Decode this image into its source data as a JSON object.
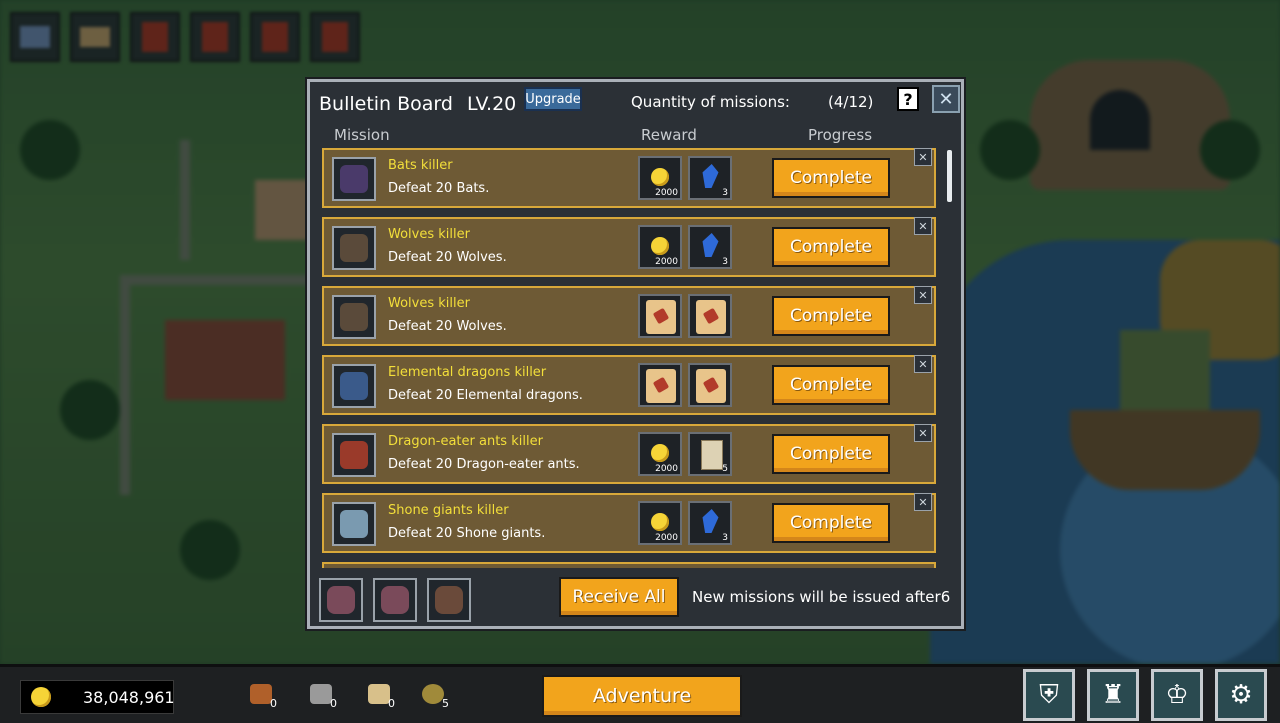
{
  "dialog": {
    "title": "Bulletin Board",
    "level": "LV.20",
    "upgrade_label": "Upgrade",
    "quantity_label": "Quantity of missions:",
    "quantity_value": "(4/12)",
    "help_label": "?",
    "close_label": "✕",
    "columns": {
      "mission": "Mission",
      "reward": "Reward",
      "progress": "Progress"
    },
    "complete_label": "Complete",
    "dismiss_label": "✕",
    "missions": [
      {
        "name": "Bats killer",
        "desc": "Defeat 20 Bats.",
        "portrait_icon": "bat-icon",
        "rewards": [
          {
            "icon": "gold-coin-icon",
            "qty": "2000"
          },
          {
            "icon": "blue-gem-icon",
            "qty": "3"
          }
        ]
      },
      {
        "name": "Wolves killer",
        "desc": "Defeat 20 Wolves.",
        "portrait_icon": "wolf-icon",
        "rewards": [
          {
            "icon": "gold-coin-icon",
            "qty": "2000"
          },
          {
            "icon": "blue-gem-icon",
            "qty": "3"
          }
        ]
      },
      {
        "name": "Wolves killer",
        "desc": "Defeat 20 Wolves.",
        "portrait_icon": "wolf-icon",
        "rewards": [
          {
            "icon": "scroll-icon",
            "qty": ""
          },
          {
            "icon": "scroll-icon",
            "qty": ""
          }
        ]
      },
      {
        "name": "Elemental dragons killer",
        "desc": "Defeat 20 Elemental dragons.",
        "portrait_icon": "dragon-icon",
        "rewards": [
          {
            "icon": "scroll-icon",
            "qty": ""
          },
          {
            "icon": "scroll-icon",
            "qty": ""
          }
        ]
      },
      {
        "name": "Dragon-eater ants killer",
        "desc": "Defeat 20 Dragon-eater ants.",
        "portrait_icon": "ant-icon",
        "rewards": [
          {
            "icon": "gold-coin-icon",
            "qty": "2000"
          },
          {
            "icon": "paper-icon",
            "qty": "5"
          }
        ]
      },
      {
        "name": "Shone giants killer",
        "desc": "Defeat 20 Shone giants.",
        "portrait_icon": "giant-icon",
        "rewards": [
          {
            "icon": "gold-coin-icon",
            "qty": "2000"
          },
          {
            "icon": "blue-gem-icon",
            "qty": "3"
          }
        ]
      }
    ],
    "receive_all_label": "Receive All",
    "new_missions_text": "New missions will be issued after6"
  },
  "bottom_bar": {
    "gold": "38,048,961",
    "resources": [
      {
        "icon": "meat-icon",
        "count": "0"
      },
      {
        "icon": "ore-icon",
        "count": "0"
      },
      {
        "icon": "scroll-icon",
        "count": "0"
      },
      {
        "icon": "bag-icon",
        "count": "5"
      }
    ],
    "adventure_label": "Adventure"
  },
  "colors": {
    "accent": "#f2a41c",
    "row_bg": "#6e5a35",
    "row_border": "#d8a83a",
    "mission_name": "#f3df3a"
  }
}
